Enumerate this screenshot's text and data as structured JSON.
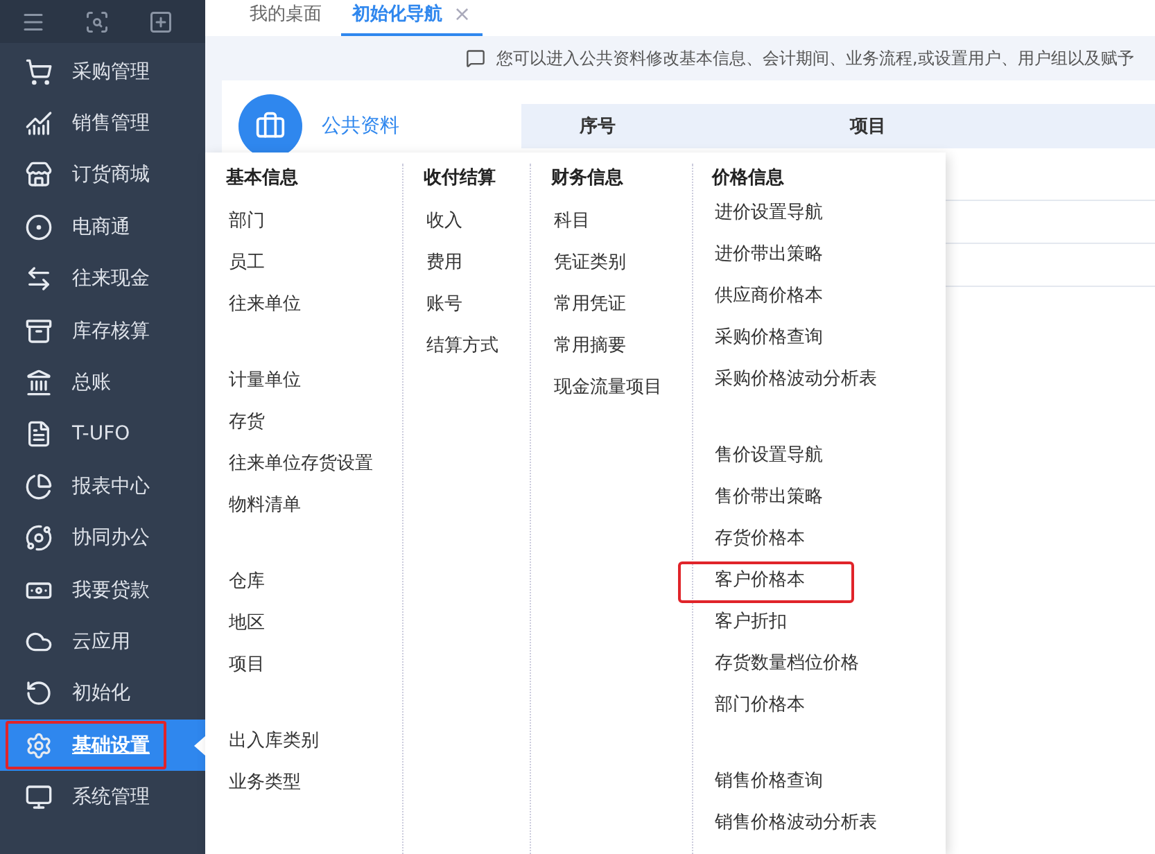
{
  "sidebar": {
    "items": [
      {
        "label": "采购管理",
        "selected": false,
        "highlighted": false
      },
      {
        "label": "销售管理",
        "selected": false,
        "highlighted": false
      },
      {
        "label": "订货商城",
        "selected": false,
        "highlighted": false
      },
      {
        "label": "电商通",
        "selected": false,
        "highlighted": false
      },
      {
        "label": "往来现金",
        "selected": false,
        "highlighted": false
      },
      {
        "label": "库存核算",
        "selected": false,
        "highlighted": false
      },
      {
        "label": "总账",
        "selected": false,
        "highlighted": false
      },
      {
        "label": "T-UFO",
        "selected": false,
        "highlighted": false
      },
      {
        "label": "报表中心",
        "selected": false,
        "highlighted": false
      },
      {
        "label": "协同办公",
        "selected": false,
        "highlighted": false
      },
      {
        "label": "我要贷款",
        "selected": false,
        "highlighted": false
      },
      {
        "label": "云应用",
        "selected": false,
        "highlighted": false
      },
      {
        "label": "初始化",
        "selected": false,
        "highlighted": false
      },
      {
        "label": "基础设置",
        "selected": true,
        "highlighted": true
      },
      {
        "label": "系统管理",
        "selected": false,
        "highlighted": false
      }
    ]
  },
  "tabs": [
    {
      "label": "我的桌面",
      "selected": false
    },
    {
      "label": "初始化导航",
      "selected": true,
      "close": "×"
    }
  ],
  "notice": "您可以进入公共资料修改基本信息、会计期间、业务流程,或设置用户、用户组以及赋予",
  "card": {
    "title": "公共资料",
    "columns": [
      "序号",
      "项目"
    ]
  },
  "menu": {
    "columns": [
      {
        "heading": "基本信息",
        "groups": [
          [
            {
              "label": "部门",
              "highlighted": false
            },
            {
              "label": "员工",
              "highlighted": false
            },
            {
              "label": "往来单位",
              "highlighted": false
            }
          ],
          [
            {
              "label": "计量单位",
              "highlighted": false
            },
            {
              "label": "存货",
              "highlighted": false
            },
            {
              "label": "往来单位存货设置",
              "highlighted": false
            },
            {
              "label": "物料清单",
              "highlighted": false
            }
          ],
          [
            {
              "label": "仓库",
              "highlighted": false
            },
            {
              "label": "地区",
              "highlighted": false
            },
            {
              "label": "项目",
              "highlighted": false
            }
          ],
          [
            {
              "label": "出入库类别",
              "highlighted": false
            },
            {
              "label": "业务类型",
              "highlighted": false
            }
          ]
        ]
      },
      {
        "heading": "收付结算",
        "groups": [
          [
            {
              "label": "收入",
              "highlighted": false
            },
            {
              "label": "费用",
              "highlighted": false
            },
            {
              "label": "账号",
              "highlighted": false
            },
            {
              "label": "结算方式",
              "highlighted": false
            }
          ]
        ]
      },
      {
        "heading": "财务信息",
        "groups": [
          [
            {
              "label": "科目",
              "highlighted": false
            },
            {
              "label": "凭证类别",
              "highlighted": false
            },
            {
              "label": "常用凭证",
              "highlighted": false
            },
            {
              "label": "常用摘要",
              "highlighted": false
            },
            {
              "label": "现金流量项目",
              "highlighted": false
            }
          ]
        ]
      },
      {
        "heading": "价格信息",
        "groups": [
          [
            {
              "label": "进价设置导航",
              "highlighted": false
            },
            {
              "label": "进价带出策略",
              "highlighted": false
            },
            {
              "label": "供应商价格本",
              "highlighted": false
            },
            {
              "label": "采购价格查询",
              "highlighted": false
            },
            {
              "label": "采购价格波动分析表",
              "highlighted": false
            }
          ],
          [
            {
              "label": "售价设置导航",
              "highlighted": false
            },
            {
              "label": "售价带出策略",
              "highlighted": false
            },
            {
              "label": "存货价格本",
              "highlighted": false
            },
            {
              "label": "客户价格本",
              "highlighted": true
            },
            {
              "label": "客户折扣",
              "highlighted": false
            },
            {
              "label": "存货数量档位价格",
              "highlighted": false
            },
            {
              "label": "部门价格本",
              "highlighted": false
            }
          ],
          [
            {
              "label": "销售价格查询",
              "highlighted": false
            },
            {
              "label": "销售价格波动分析表",
              "highlighted": false
            }
          ]
        ]
      }
    ]
  }
}
